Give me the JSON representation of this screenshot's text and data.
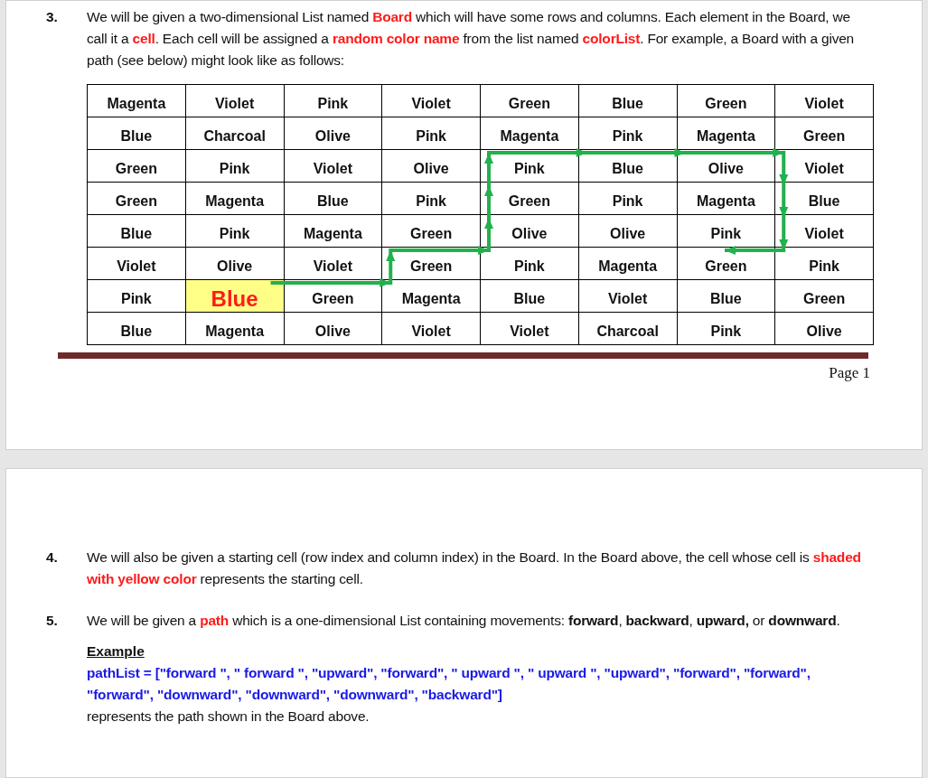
{
  "pages": [
    {
      "items": [
        {
          "number": "3.",
          "segments": [
            {
              "kind": "plain",
              "text": "We will be given a two-dimensional List named "
            },
            {
              "kind": "red",
              "text": "Board"
            },
            {
              "kind": "plain",
              "text": " which will have some rows and columns. Each element in the Board, we call it a "
            },
            {
              "kind": "red",
              "text": "cell"
            },
            {
              "kind": "plain",
              "text": ". Each cell will be assigned a "
            },
            {
              "kind": "red",
              "text": "random color name"
            },
            {
              "kind": "plain",
              "text": " from the list named "
            },
            {
              "kind": "red",
              "text": "colorList"
            },
            {
              "kind": "plain",
              "text": ". For example, a Board with a given path (see below) might look like as follows:"
            }
          ]
        }
      ],
      "board": {
        "rows": [
          [
            {
              "text": "Magenta",
              "start": false
            },
            {
              "text": "Violet",
              "start": false
            },
            {
              "text": "Pink",
              "start": false
            },
            {
              "text": "Violet",
              "start": false
            },
            {
              "text": "Green",
              "start": false
            },
            {
              "text": "Blue",
              "start": false
            },
            {
              "text": "Green",
              "start": false
            },
            {
              "text": "Violet",
              "start": false
            }
          ],
          [
            {
              "text": "Blue",
              "start": false
            },
            {
              "text": "Charcoal",
              "start": false
            },
            {
              "text": "Olive",
              "start": false
            },
            {
              "text": "Pink",
              "start": false
            },
            {
              "text": "Magenta",
              "start": false
            },
            {
              "text": "Pink",
              "start": false
            },
            {
              "text": "Magenta",
              "start": false
            },
            {
              "text": "Green",
              "start": false
            }
          ],
          [
            {
              "text": "Green",
              "start": false
            },
            {
              "text": "Pink",
              "start": false
            },
            {
              "text": "Violet",
              "start": false
            },
            {
              "text": "Olive",
              "start": false
            },
            {
              "text": "Pink",
              "start": false
            },
            {
              "text": "Blue",
              "start": false
            },
            {
              "text": "Olive",
              "start": false
            },
            {
              "text": "Violet",
              "start": false
            }
          ],
          [
            {
              "text": "Green",
              "start": false
            },
            {
              "text": "Magenta",
              "start": false
            },
            {
              "text": "Blue",
              "start": false
            },
            {
              "text": "Pink",
              "start": false
            },
            {
              "text": "Green",
              "start": false
            },
            {
              "text": "Pink",
              "start": false
            },
            {
              "text": "Magenta",
              "start": false
            },
            {
              "text": "Blue",
              "start": false
            }
          ],
          [
            {
              "text": "Blue",
              "start": false
            },
            {
              "text": "Pink",
              "start": false
            },
            {
              "text": "Magenta",
              "start": false
            },
            {
              "text": "Green",
              "start": false
            },
            {
              "text": "Olive",
              "start": false
            },
            {
              "text": "Olive",
              "start": false
            },
            {
              "text": "Pink",
              "start": false
            },
            {
              "text": "Violet",
              "start": false
            }
          ],
          [
            {
              "text": "Violet",
              "start": false
            },
            {
              "text": "Olive",
              "start": false
            },
            {
              "text": "Violet",
              "start": false
            },
            {
              "text": "Green",
              "start": false
            },
            {
              "text": "Pink",
              "start": false
            },
            {
              "text": "Magenta",
              "start": false
            },
            {
              "text": "Green",
              "start": false
            },
            {
              "text": "Pink",
              "start": false
            }
          ],
          [
            {
              "text": "Pink",
              "start": false
            },
            {
              "text": "Blue",
              "start": true
            },
            {
              "text": "Green",
              "start": false
            },
            {
              "text": "Magenta",
              "start": false
            },
            {
              "text": "Blue",
              "start": false
            },
            {
              "text": "Violet",
              "start": false
            },
            {
              "text": "Blue",
              "start": false
            },
            {
              "text": "Green",
              "start": false
            }
          ],
          [
            {
              "text": "Blue",
              "start": false
            },
            {
              "text": "Magenta",
              "start": false
            },
            {
              "text": "Olive",
              "start": false
            },
            {
              "text": "Violet",
              "start": false
            },
            {
              "text": "Violet",
              "start": false
            },
            {
              "text": "Charcoal",
              "start": false
            },
            {
              "text": "Pink",
              "start": false
            },
            {
              "text": "Olive",
              "start": false
            }
          ]
        ]
      },
      "footer": "Page 1"
    },
    {
      "items": [
        {
          "number": "4.",
          "segments": [
            {
              "kind": "plain",
              "text": "We will also be given a starting cell (row index and column index) in the Board. In the Board above, the cell whose cell is "
            },
            {
              "kind": "red",
              "text": "shaded with yellow color"
            },
            {
              "kind": "plain",
              "text": " represents the starting cell."
            }
          ]
        },
        {
          "number": "5.",
          "segments": [
            {
              "kind": "plain",
              "text": "We will be given a "
            },
            {
              "kind": "red",
              "text": "path"
            },
            {
              "kind": "plain",
              "text": " which is a one-dimensional List containing movements: "
            },
            {
              "kind": "bold",
              "text": "forward"
            },
            {
              "kind": "plain",
              "text": ", "
            },
            {
              "kind": "bold",
              "text": "backward"
            },
            {
              "kind": "plain",
              "text": ", "
            },
            {
              "kind": "bold",
              "text": "upward,"
            },
            {
              "kind": "plain",
              "text": " or "
            },
            {
              "kind": "bold",
              "text": "downward"
            },
            {
              "kind": "plain",
              "text": "."
            }
          ],
          "example": {
            "heading": "Example",
            "code": "pathList = [\"forward \", \" forward \", \"upward\", \"forward\", \" upward \", \" upward \", \"upward\", \"forward\", \"forward\", \"forward\", \"downward\", \"downward\", \"downward\", \"backward\"]",
            "note": "represents the path shown in the Board above."
          }
        }
      ]
    }
  ]
}
